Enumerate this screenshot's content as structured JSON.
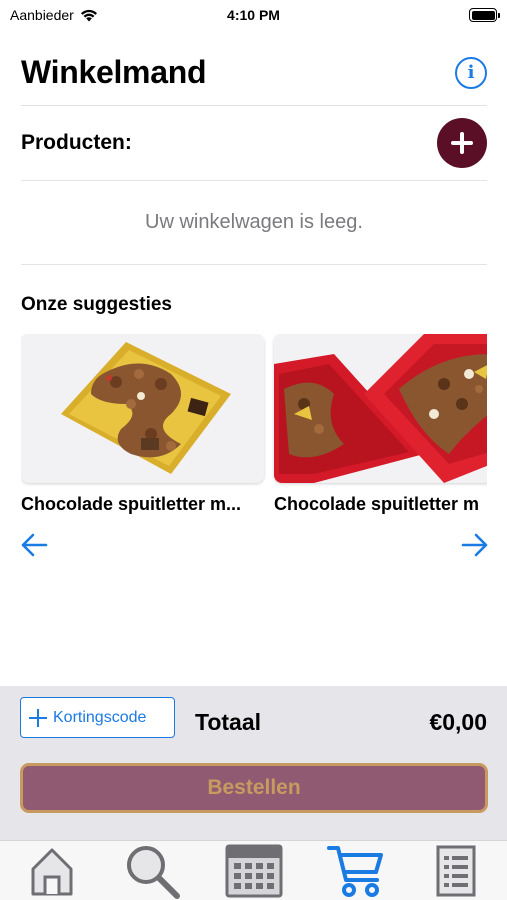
{
  "status_bar": {
    "carrier": "Aanbieder",
    "time": "4:10 PM"
  },
  "header": {
    "title": "Winkelmand",
    "info_icon": "info-icon"
  },
  "products": {
    "label": "Producten:",
    "add_icon": "plus-icon"
  },
  "cart": {
    "empty_message": "Uw winkelwagen is leeg."
  },
  "suggestions": {
    "title": "Onze suggesties",
    "items": [
      {
        "title": "Chocolade spuitletter m...",
        "image": "gold-box-chocolate-letter"
      },
      {
        "title": "Chocolade spuitletter m",
        "image": "red-box-chocolate-letters"
      }
    ]
  },
  "summary": {
    "coupon_label": "Kortingscode",
    "total_label": "Totaal",
    "total_value": "€0,00",
    "order_label": "Bestellen"
  },
  "tabs": [
    {
      "name": "home",
      "icon": "home-icon"
    },
    {
      "name": "search",
      "icon": "search-icon"
    },
    {
      "name": "calendar",
      "icon": "calendar-icon"
    },
    {
      "name": "cart",
      "icon": "cart-icon",
      "active": true
    },
    {
      "name": "list",
      "icon": "list-icon"
    }
  ],
  "colors": {
    "accent": "#1a7be3",
    "brand": "#5a0f27",
    "order_button_bg": "#8f5a72",
    "order_button_text": "#c89a5f"
  }
}
